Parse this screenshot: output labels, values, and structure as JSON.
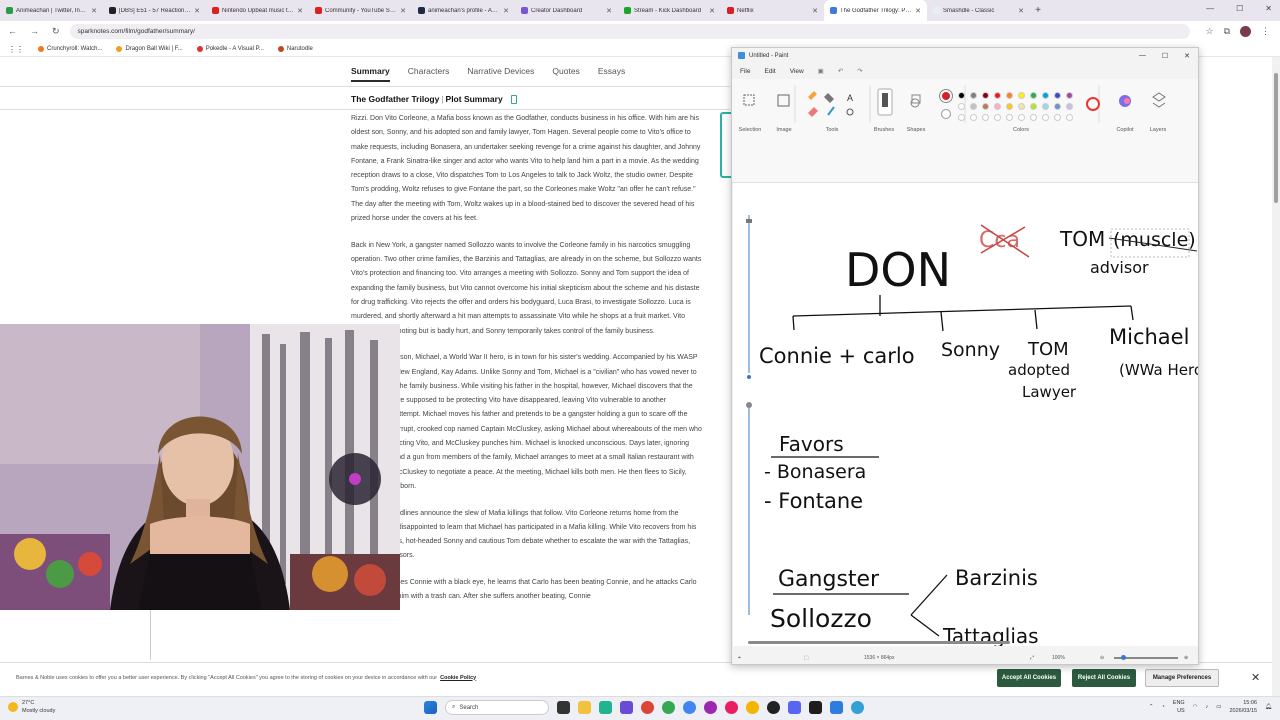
{
  "browser": {
    "tabs": [
      {
        "label": "Animeachan | Twitter, Instagr",
        "color": "#2a9d4a",
        "active": false
      },
      {
        "label": "[DBS] E51 - 57 Reaction & Th",
        "color": "#222222",
        "active": false
      },
      {
        "label": "Nintendo Upbeat music to wi",
        "color": "#e02020",
        "active": false
      },
      {
        "label": "Community - YouTube Studio",
        "color": "#e02020",
        "active": false
      },
      {
        "label": "animeachan's profile - AniList",
        "color": "#1e2a44",
        "active": false
      },
      {
        "label": "Creator Dashboard",
        "color": "#7a55d0",
        "active": false
      },
      {
        "label": "Stream - Kick Dashboard",
        "color": "#1aa52b",
        "active": false
      },
      {
        "label": "Netflix",
        "color": "#d91f26",
        "active": false
      },
      {
        "label": "The Godfather Trilogy: Plot Su",
        "color": "#3b7ad8",
        "active": true
      },
      {
        "label": "Smashdle - Classic",
        "color": "#e8eef6",
        "active": false
      }
    ],
    "url": "sparknotes.com/film/godfather/summary/",
    "bookmarks": [
      {
        "label": "Crunchyroll: Watch...",
        "color": "#f47521"
      },
      {
        "label": "Dragon Ball Wiki | F...",
        "color": "#f0a020"
      },
      {
        "label": "Pokedle - A Visual P...",
        "color": "#d33"
      },
      {
        "label": "Narutodle",
        "color": "#c04a20"
      }
    ]
  },
  "site": {
    "nav": [
      "Summary",
      "Characters",
      "Narrative Devices",
      "Quotes",
      "Essays"
    ],
    "title_left": "The Godfather Trilogy",
    "title_right": "Plot Summary",
    "paragraphs": [
      "Rizzi. Don Vito Corleone, a Mafia boss known as the Godfather, conducts business in his office. With him are his oldest son, Sonny, and his adopted son and family lawyer, Tom Hagen. Several people come to Vito's office to make requests, including Bonasera, an undertaker seeking revenge for a crime against his daughter, and Johnny Fontane, a Frank Sinatra-like singer and actor who wants Vito to help land him a part in a movie. As the wedding reception draws to a close, Vito dispatches Tom to Los Angeles to talk to Jack Woltz, the studio owner. Despite Tom's prodding, Woltz refuses to give Fontane the part, so the Corleones make Woltz \"an offer he can't refuse.\" The day after the meeting with Tom, Woltz wakes up in a blood-stained bed to discover the severed head of his prized horse under the covers at his feet.",
      "Back in New York, a gangster named Sollozzo wants to involve the Corleone family in his narcotics smuggling operation. Two other crime families, the Barzinis and Tattaglias, are already in on the scheme, but Sollozzo wants Vito's protection and financing too. Vito arranges a meeting with Sollozzo. Sonny and Tom support the idea of expanding the family business, but Vito cannot overcome his initial skepticism about the scheme and his distaste for drug trafficking. Vito rejects the offer and orders his bodyguard, Luca Brasi, to investigate Sollozzo. Luca is murdered, and shortly afterward a hit man attempts to assassinate Vito while he shops at a fruit market. Vito survives the shooting but is badly hurt, and Sonny temporarily takes control of the family business.",
      "Vito's youngest son, Michael, a World War II hero, is in town for his sister's wedding. Accompanied by his WASP girlfriend from New England, Kay Adams. Unlike Sonny and Tom, Michael is a \"civilian\" who has vowed never to get involved in the family business. While visiting his father in the hospital, however, Michael discovers that the guards who were supposed to be protecting Vito have disappeared, leaving Vito vulnerable to another assassination attempt. Michael moves his father and pretends to be a gangster holding a gun to scare off the assassins. A corrupt, crooked cop named Captain McCluskey, asking Michael about whereabouts of the men who should be protecting Vito, and McCluskey punches him. Michael is knocked unconscious. Days later, ignoring Tom's advice and a gun from members of the family, Michael arranges to meet at a small Italian restaurant with Sollozzo and McCluskey to negotiate a peace. At the meeting, Michael kills both men. He then flees to Sicily, where Vito was born.",
      "Newspaper headlines announce the slew of Mafia killings that follow. Vito Corleone returns home from the hospital and is disappointed to learn that Michael has participated in a Mafia killing. While Vito recovers from his gunshot wounds, hot-headed Sonny and cautious Tom debate whether to escalate the war with the Tattaglias, Sollozzo's sponsors.",
      "When Sonny sees Connie with a black eye, he learns that Carlo has been beating Connie, and he attacks Carlo brutally, hitting him with a trash can. After she suffers another beating, Connie"
    ]
  },
  "cookie": {
    "text": "Barnes & Noble uses cookies to offer you a better user experience. By clicking \"Accept All Cookies\" you agree to the storing of cookies on your device in accordance with our",
    "link": "Cookie Policy",
    "accept": "Accept All Cookies",
    "reject": "Reject All Cookies",
    "prefs": "Manage Preferences"
  },
  "paint": {
    "title": "Untitled - Paint",
    "menu": [
      "File",
      "Edit",
      "View"
    ],
    "groups": [
      "Selection",
      "Image",
      "Tools",
      "Brushes",
      "Shapes",
      "Colors",
      "Copilot",
      "Layers"
    ],
    "palette_row1": [
      "#000000",
      "#7f7f7f",
      "#880015",
      "#ed1c24",
      "#ff7f27",
      "#fff200",
      "#22b14c",
      "#00a2e8",
      "#3f48cc",
      "#a349a4"
    ],
    "palette_row2": [
      "#ffffff",
      "#c3c3c3",
      "#b97a57",
      "#ffaec9",
      "#ffc90e",
      "#efe4b0",
      "#b5e61d",
      "#99d9ea",
      "#7092be",
      "#c8bfe7"
    ],
    "active_color": "#d81e28",
    "canvas_size": "1536 × 864px",
    "zoom": "100%",
    "handwriting": {
      "crossed": "Cca",
      "don": "DON",
      "tom_advisor_top": "TOM",
      "muscle": "(muscle)",
      "advisor": "advisor",
      "connie": "Connie + carlo",
      "sonny": "Sonny",
      "tom": "TOM",
      "adopted": "adopted",
      "lawyer": "Lawyer",
      "michael": "Michael",
      "ww_hero": "(WWa Hero)",
      "favors": "Favors",
      "bonasera": "- Bonasera",
      "fontane": "- Fontane",
      "gangster": "Gangster",
      "sollozzo": "Sollozzo",
      "barzinis": "Barzinis",
      "tattaglias": "Tattaglias"
    }
  },
  "taskbar": {
    "weather_temp": "27°C",
    "weather_desc": "Mostly cloudy",
    "search": "Search",
    "lang1": "ENG",
    "lang2": "US",
    "time": "15:06",
    "date": "2026/03/15"
  }
}
